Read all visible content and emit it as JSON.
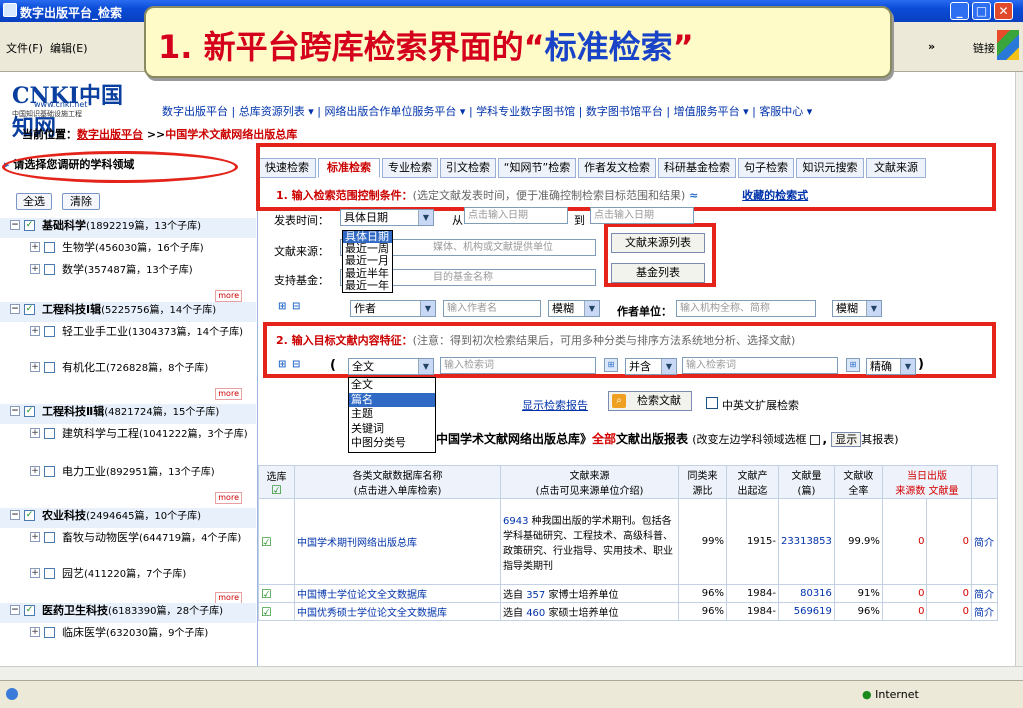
{
  "window": {
    "title": "数字出版平台_检索",
    "min": "_",
    "max": "□",
    "close": "✕"
  },
  "menu": {
    "file": "文件(F)",
    "edit": "编辑(E)",
    "overflow": "»",
    "links": "链接"
  },
  "logo": {
    "name": "CNKI中国知网",
    "url": "www.cnki.net",
    "subtitle": "中国知识基础设施工程"
  },
  "topnav": [
    "数字出版平台",
    "总库资源列表 ▾",
    "网络出版合作单位服务平台 ▾",
    "学科专业数字图书馆",
    "数字图书馆平台",
    "增值服务平台 ▾",
    "客服中心 ▾"
  ],
  "breadcrumb": {
    "label": "当前位置：",
    "link": "数字出版平台",
    "sep": ">>",
    "current": "中国学术文献网络出版总库"
  },
  "callout": {
    "prefix": "1. 新平台跨库检索界面的“",
    "highlight": "标准检索",
    "suffix": "”"
  },
  "sidebar": {
    "heading": "请选择您调研的学科领域",
    "select_all": "全选",
    "clear": "清除",
    "more": "more",
    "rows": [
      {
        "type": "cat",
        "name": "基础科学",
        "count": "(1892219篇，13个子库)"
      },
      {
        "type": "sub",
        "name": "生物学",
        "count": "(456030篇，16个子库)"
      },
      {
        "type": "sub",
        "name": "数学",
        "count": "(357487篇，13个子库)",
        "more": true
      },
      {
        "type": "cat",
        "name": "工程科技Ⅰ辑",
        "count": "(5225756篇，14个子库)"
      },
      {
        "type": "sub",
        "name": "轻工业手工业",
        "count": "(1304373篇，14个子库)"
      },
      {
        "type": "sub",
        "name": "有机化工",
        "count": "(726828篇，8个子库)",
        "more": true
      },
      {
        "type": "cat",
        "name": "工程科技Ⅱ辑",
        "count": "(4821724篇，15个子库)"
      },
      {
        "type": "sub",
        "name": "建筑科学与工程",
        "count": "(1041222篇，3个子库)"
      },
      {
        "type": "sub",
        "name": "电力工业",
        "count": "(892951篇，13个子库)",
        "more": true
      },
      {
        "type": "cat",
        "name": "农业科技",
        "count": "(2494645篇，10个子库)"
      },
      {
        "type": "sub",
        "name": "畜牧与动物医学",
        "count": "(644719篇，4个子库)"
      },
      {
        "type": "sub",
        "name": "园艺",
        "count": "(411220篇，7个子库)",
        "more": true
      },
      {
        "type": "cat",
        "name": "医药卫生科技",
        "count": "(6183390篇，28个子库)"
      },
      {
        "type": "sub",
        "name": "临床医学",
        "count": "(632030篇，9个子库)"
      }
    ]
  },
  "tabs": [
    "快速检索",
    "标准检索",
    "专业检索",
    "引文检索",
    "“知网节”检索",
    "作者发文检索",
    "科研基金检索",
    "句子检索",
    "知识元搜索",
    "文献来源"
  ],
  "section1": {
    "title": "1. 输入检索范围控制条件：",
    "note": "(选定文献发表时间，便于准确控制检索目标范围和结果)",
    "collapse": "≈",
    "saved_link": "收藏的检索式"
  },
  "pubtime": {
    "label": "发表时间：",
    "selected": "具体日期",
    "from": "从",
    "from_placeholder": "点击输入日期",
    "to": "到",
    "to_placeholder": "点击输入日期"
  },
  "date_options": [
    "具体日期",
    "最近一周",
    "最近一月",
    "最近半年",
    "最近一年"
  ],
  "source": {
    "label": "文献来源：",
    "placeholder": "媒体、机构或文献提供单位",
    "list_button": "文献来源列表"
  },
  "fund": {
    "label": "支持基金：",
    "placeholder": "目的基金名称",
    "list_button": "基金列表"
  },
  "author_row": {
    "plus": "⊞",
    "minus": "⊟",
    "field": "作者",
    "placeholder": "输入作者名",
    "match": "模糊",
    "unit_label": "作者单位：",
    "unit_placeholder": "输入机构全称、简称",
    "unit_match": "模糊"
  },
  "section2": {
    "title": "2. 输入目标文献内容特征：",
    "note": "(注意：得到初次检索结果后，可用多种分类与排序方法系统地分析、选择文献)"
  },
  "content_row": {
    "paren_open": "(",
    "paren_close": ")",
    "field": "全文",
    "placeholder1": "输入检索词",
    "op": "并含",
    "placeholder2": "输入检索词",
    "match": "精确"
  },
  "field_options": [
    "全文",
    "篇名",
    "主题",
    "关键词",
    "中图分类号"
  ],
  "actions": {
    "report": "显示检索报告",
    "search": "检索文献",
    "ext": "中英文扩展检索"
  },
  "table_title": {
    "prefix": "中国学术文献网络出版总库》",
    "red": "全部",
    "suffix": "文献出版报表",
    "small1": "(改变左边学科领域选框",
    "show": "显示",
    "small2": "其报表)"
  },
  "table": {
    "headers": [
      "选库",
      "各类文献数据库名称",
      "文献来源",
      "同类来",
      "文献产",
      "文献量",
      "文献收",
      "当日出版"
    ],
    "subheaders": [
      "(点击进入单库检索)",
      "(点击可见来源单位介绍)",
      "源比",
      "出起迄",
      "(篇)",
      "全率",
      "来源数",
      "文献量"
    ],
    "rows": [
      {
        "name": "中国学术期刊网络出版总库",
        "source_count": "6943",
        "source_text": "种我国出版的学术期刊。包括各学科基础研究、工程技术、高级科普、政策研究、行业指导、实用技术、职业指导类期刊",
        "ratio": "99%",
        "years": "1915-",
        "count": "23313853",
        "rate": "99.9%",
        "today_src": "0",
        "today_cnt": "0",
        "intro": "简介"
      },
      {
        "name": "中国博士学位论文全文数据库",
        "source_count": "357",
        "source_text": "家博士培养单位",
        "ratio": "96%",
        "years": "1984-",
        "count": "80316",
        "rate": "91%",
        "today_src": "0",
        "today_cnt": "0",
        "intro": "简介"
      },
      {
        "name": "中国优秀硕士学位论文全文数据库",
        "source_count": "460",
        "source_text": "家硕士培养单位",
        "ratio": "96%",
        "years": "1984-",
        "count": "569619",
        "rate": "96%",
        "today_src": "0",
        "today_cnt": "0",
        "intro": "简介"
      }
    ],
    "choose_prefix": "选自"
  },
  "status": {
    "zone": "Internet"
  },
  "colors": {
    "highlight_red": "#e4241a",
    "link_blue": "#0033aa",
    "title_blue": "#0a4bd6"
  }
}
